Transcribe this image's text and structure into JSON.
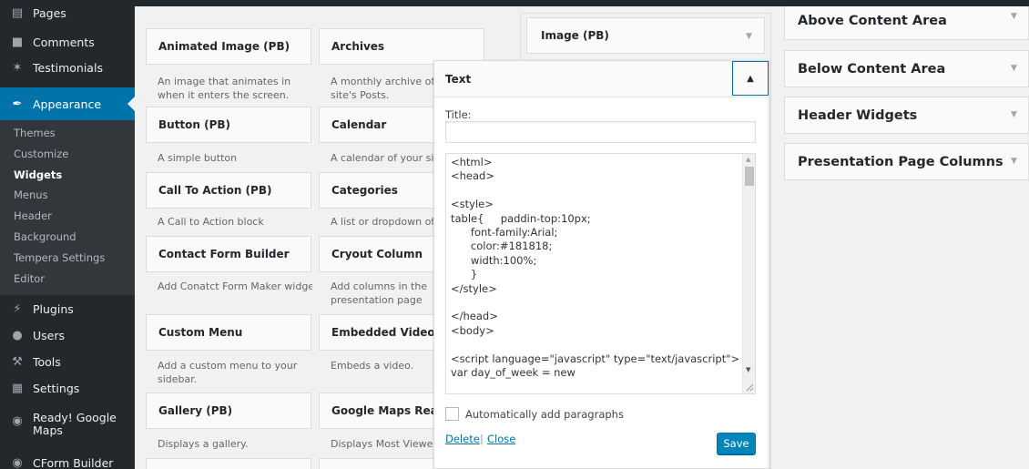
{
  "sidebar": {
    "items": [
      {
        "label": "Pages",
        "icon": "pages-icon"
      },
      {
        "label": "Comments",
        "icon": "comments-icon"
      },
      {
        "label": "Testimonials",
        "icon": "testimonials-icon"
      },
      {
        "label": "Appearance",
        "icon": "appearance-icon"
      },
      {
        "label": "Plugins",
        "icon": "plugins-icon"
      },
      {
        "label": "Users",
        "icon": "users-icon"
      },
      {
        "label": "Tools",
        "icon": "tools-icon"
      },
      {
        "label": "Settings",
        "icon": "settings-icon"
      },
      {
        "label": "Ready! Google Maps",
        "icon": "google-maps-icon"
      },
      {
        "label": "CForm Builder",
        "icon": "cform-icon"
      }
    ],
    "submenu": [
      "Themes",
      "Customize",
      "Widgets",
      "Menus",
      "Header",
      "Background",
      "Tempera Settings",
      "Editor"
    ],
    "current_submenu": "Widgets"
  },
  "available_widgets": [
    {
      "title": "Animated Image (PB)",
      "desc": "An image that animates in when it enters the screen."
    },
    {
      "title": "Archives",
      "desc": "A monthly archive of your site's Posts."
    },
    {
      "title": "Button (PB)",
      "desc": "A simple button"
    },
    {
      "title": "Calendar",
      "desc": "A calendar of your site's Posts."
    },
    {
      "title": "Call To Action (PB)",
      "desc": "A Call to Action block"
    },
    {
      "title": "Categories",
      "desc": "A list or dropdown of categories."
    },
    {
      "title": "Contact Form Builder",
      "desc": "Add Conatct Form Maker widget."
    },
    {
      "title": "Cryout Column",
      "desc": "Add columns in the presentation page"
    },
    {
      "title": "Custom Menu",
      "desc": "Add a custom menu to your sidebar."
    },
    {
      "title": "Embedded Video (PB)",
      "desc": "Embeds a video."
    },
    {
      "title": "Gallery (PB)",
      "desc": "Displays a gallery."
    },
    {
      "title": "Google Maps Ready!",
      "desc": "Displays Most Viewed Products."
    }
  ],
  "middle_sidebar": {
    "widget_title": "Image (PB)"
  },
  "text_widget": {
    "title": "Text",
    "title_label": "Title:",
    "title_value": "",
    "code": "<html>\n<head>\n\n<style>\ntable{     paddin-top:10px;\n      font-family:Arial;\n      color:#181818;\n      width:100%;\n      }\n</style>\n\n</head>\n<body>\n\n<script language=\"javascript\" type=\"text/javascript\">\nvar day_of_week = new",
    "autop_label": "Automatically add paragraphs",
    "autop_checked": false,
    "delete_label": "Delete",
    "separator": "|",
    "close_label": "Close",
    "save_label": "Save"
  },
  "right_sidebars": [
    {
      "title": "Above Content Area"
    },
    {
      "title": "Below Content Area"
    },
    {
      "title": "Header Widgets"
    },
    {
      "title": "Presentation Page Columns"
    }
  ],
  "colors": {
    "admin_bar": "#23282d",
    "submenu_bg": "#32373c",
    "active_blue": "#0073aa",
    "save_button": "#0085ba",
    "page_bg": "#f1f1f1"
  }
}
